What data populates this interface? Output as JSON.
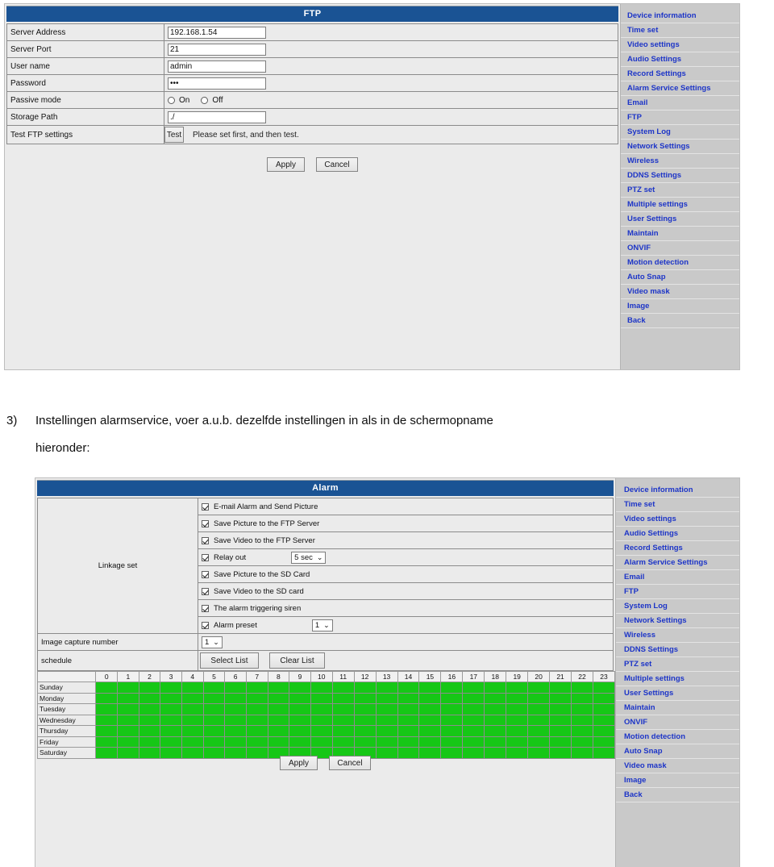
{
  "document": {
    "list_number": "3)",
    "paragraph_line1": "Instellingen alarmservice, voer a.u.b. dezelfde instellingen in als in de schermopname",
    "paragraph_line2": "hieronder:"
  },
  "colors": {
    "titlebar_blue": "#1a5394",
    "menu_link_blue": "#1d35c8",
    "schedule_green": "#16c716",
    "panel_bg": "#ebebeb",
    "sidebar_bg": "#c9c9c9"
  },
  "ftp_panel": {
    "title": "FTP",
    "rows": [
      {
        "label": "Server Address",
        "value": "192.168.1.54"
      },
      {
        "label": "Server Port",
        "value": "21"
      },
      {
        "label": "User name",
        "value": "admin"
      },
      {
        "label": "Password",
        "value": "•••"
      },
      {
        "label": "Storage Path",
        "value": "./"
      }
    ],
    "passive_mode": {
      "label": "Passive mode",
      "option_on": "On",
      "option_off": "Off",
      "selected": "On"
    },
    "test_row": {
      "label": "Test FTP settings",
      "button": "Test",
      "hint": "Please set first, and then test."
    },
    "apply_label": "Apply",
    "cancel_label": "Cancel"
  },
  "alarm_panel": {
    "title": "Alarm",
    "linkage_label": "Linkage set",
    "linkage_items": [
      {
        "label": "E-mail Alarm and Send Picture",
        "checked": true,
        "control": null
      },
      {
        "label": "Save Picture to the FTP Server",
        "checked": true,
        "control": null
      },
      {
        "label": "Save Video to the FTP Server",
        "checked": true,
        "control": null
      },
      {
        "label": "Relay out",
        "checked": true,
        "control": "5 sec"
      },
      {
        "label": "Save Picture to the SD Card",
        "checked": true,
        "control": null
      },
      {
        "label": "Save Video to the SD card",
        "checked": true,
        "control": null
      },
      {
        "label": "The alarm triggering siren",
        "checked": true,
        "control": null
      },
      {
        "label": "Alarm preset",
        "checked": true,
        "control": "1"
      }
    ],
    "image_capture_number": {
      "label": "Image capture number",
      "value": "1"
    },
    "schedule": {
      "label": "schedule",
      "select_list_label": "Select List",
      "clear_list_label": "Clear List",
      "hours": [
        "0",
        "1",
        "2",
        "3",
        "4",
        "5",
        "6",
        "7",
        "8",
        "9",
        "10",
        "11",
        "12",
        "13",
        "14",
        "15",
        "16",
        "17",
        "18",
        "19",
        "20",
        "21",
        "22",
        "23"
      ],
      "days": [
        "Sunday",
        "Monday",
        "Tuesday",
        "Wednesday",
        "Thursday",
        "Friday",
        "Saturday"
      ],
      "all_selected": true
    },
    "apply_label": "Apply",
    "cancel_label": "Cancel"
  },
  "sidebar_menu": {
    "items": [
      "Device information",
      "Time set",
      "Video settings",
      "Audio Settings",
      "Record Settings",
      "Alarm Service Settings",
      "Email",
      "FTP",
      "System Log",
      "Network Settings",
      "Wireless",
      "DDNS Settings",
      "PTZ set",
      "Multiple settings",
      "User Settings",
      "Maintain",
      "ONVIF",
      "Motion detection",
      "Auto Snap",
      "Video mask",
      "Image",
      "Back"
    ]
  }
}
